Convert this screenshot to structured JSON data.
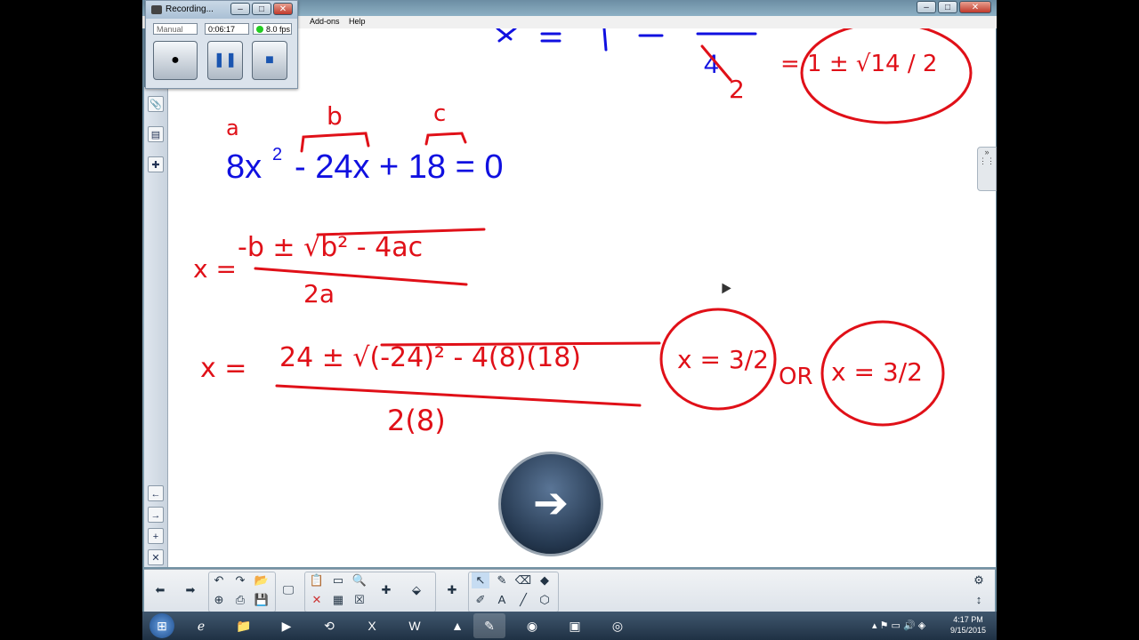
{
  "recorder": {
    "title": "Recording...",
    "mode": "Manual",
    "time": "0:06:17",
    "fps": "8.0 fps",
    "status_color": "#22cc22"
  },
  "menu": {
    "addons": "Add-ons",
    "help": "Help"
  },
  "math": {
    "label_a": "a",
    "label_b": "b",
    "label_c": "c",
    "eq_8x": "8x",
    "eq_sq": "2",
    "eq_rest": "- 24x + 18 = 0",
    "formula_x": "x =",
    "formula_num": "-b ± √b² - 4ac",
    "formula_den": "2a",
    "sub_x": "x =",
    "sub_num": "24 ± √(-24)² - 4(8)(18)",
    "sub_den": "2(8)",
    "sol1": "x = 3/2",
    "sol_or": "OR",
    "sol2": "x = 3/2",
    "top_eq": "= 1 ± √14 / 2",
    "top_frac_den": "2",
    "top_crossed": "4"
  },
  "taskbar": {
    "time": "4:17 PM",
    "date": "9/15/2015"
  },
  "icons": {
    "play": "arrow-right-icon"
  }
}
